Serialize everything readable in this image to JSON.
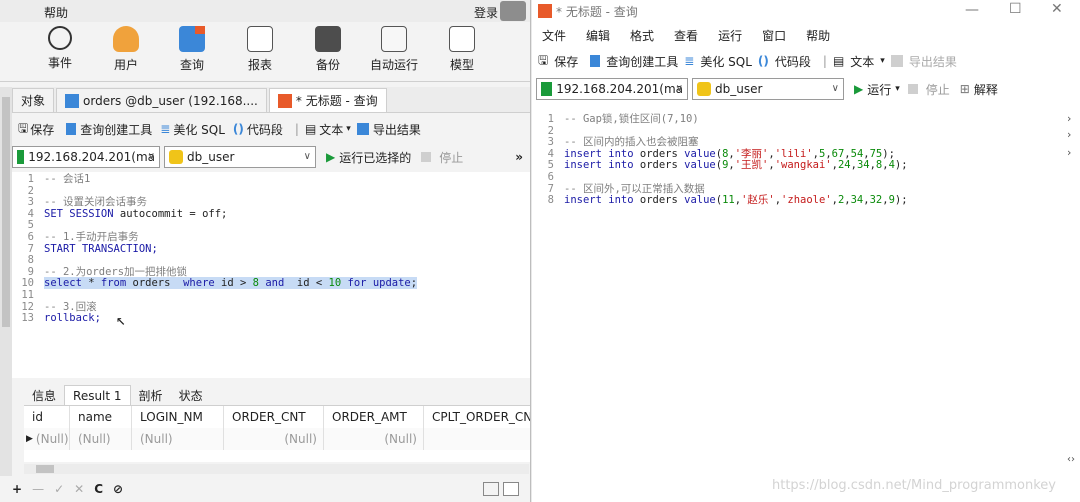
{
  "left": {
    "menu": {
      "help": "帮助",
      "login": "登录"
    },
    "ribbon": [
      {
        "label": "事件",
        "icon": "clock-icon"
      },
      {
        "label": "用户",
        "icon": "user-icon"
      },
      {
        "label": "查询",
        "icon": "query-icon"
      },
      {
        "label": "报表",
        "icon": "report-icon"
      },
      {
        "label": "备份",
        "icon": "backup-icon"
      },
      {
        "label": "自动运行",
        "icon": "automation-icon"
      },
      {
        "label": "模型",
        "icon": "model-icon"
      }
    ],
    "object_tabs": [
      "对象",
      "orders @db_user (192.168....",
      "* 无标题 - 查询"
    ],
    "toolbar": {
      "save": "保存",
      "builder": "查询创建工具",
      "beautify": "美化 SQL",
      "snippet": "代码段",
      "text": "文本",
      "export": "导出结果"
    },
    "connection": {
      "host": "192.168.204.201(ma",
      "db": "db_user",
      "run": "运行已选择的",
      "stop": "停止"
    },
    "code": [
      {
        "n": "1",
        "t": "-- 会话1",
        "c": "cm"
      },
      {
        "n": "2",
        "t": "",
        "c": ""
      },
      {
        "n": "3",
        "t": "-- 设置关闭会话事务",
        "c": "cm"
      },
      {
        "n": "4",
        "t": "SET SESSION autocommit = off;",
        "c": ""
      },
      {
        "n": "5",
        "t": "",
        "c": ""
      },
      {
        "n": "6",
        "t": "-- 1.手动开启事务",
        "c": "cm"
      },
      {
        "n": "7",
        "t": "START TRANSACTION;",
        "c": "kw"
      },
      {
        "n": "8",
        "t": "",
        "c": ""
      },
      {
        "n": "9",
        "t": "-- 2.为orders加一把排他锁",
        "c": "cm"
      },
      {
        "n": "10",
        "t": "select * from orders  where id > 8 and  id < 10 for update;",
        "c": "sel"
      },
      {
        "n": "11",
        "t": "",
        "c": ""
      },
      {
        "n": "12",
        "t": "-- 3.回滚",
        "c": "cm"
      },
      {
        "n": "13",
        "t": "rollback;",
        "c": "kw"
      }
    ],
    "result_tabs": [
      "信息",
      "Result 1",
      "剖析",
      "状态"
    ],
    "grid_headers": [
      "id",
      "name",
      "LOGIN_NM",
      "ORDER_CNT",
      "ORDER_AMT",
      "CPLT_ORDER_CN"
    ],
    "grid_row": [
      "(Null)",
      "(Null)",
      "(Null)",
      "(Null)",
      "(Null)",
      ""
    ],
    "status_icons": [
      "+",
      "—",
      "✓",
      "✕",
      "C",
      "⊘"
    ]
  },
  "right": {
    "title": "* 无标题 - 查询",
    "menu": [
      "文件",
      "编辑",
      "格式",
      "查看",
      "运行",
      "窗口",
      "帮助"
    ],
    "toolbar": {
      "save": "保存",
      "builder": "查询创建工具",
      "beautify": "美化 SQL",
      "snippet": "代码段",
      "text": "文本",
      "export": "导出结果"
    },
    "connection": {
      "host": "192.168.204.201(ma",
      "db": "db_user",
      "run": "运行",
      "stop": "停止",
      "explain": "解释"
    },
    "code": [
      {
        "n": "1",
        "t": "-- Gap锁,锁住区间(7,10)",
        "c": "cm"
      },
      {
        "n": "2",
        "t": "",
        "c": ""
      },
      {
        "n": "3",
        "t": "-- 区间内的插入也会被阻塞",
        "c": "cm"
      },
      {
        "n": "4",
        "t": "insert into orders value(8,'李丽','lili',5,67,54,75);",
        "c": ""
      },
      {
        "n": "5",
        "t": "insert into orders value(9,'王凯','wangkai',24,34,8,4);",
        "c": ""
      },
      {
        "n": "6",
        "t": "",
        "c": ""
      },
      {
        "n": "7",
        "t": "-- 区间外,可以正常插入数据",
        "c": "cm"
      },
      {
        "n": "8",
        "t": "insert into orders value(11,'赵乐','zhaole',2,34,32,9);",
        "c": ""
      }
    ],
    "watermark": "https://blog.csdn.net/Mind_programmonkey"
  }
}
